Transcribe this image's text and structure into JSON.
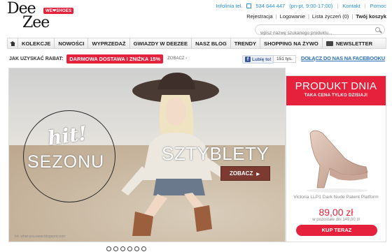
{
  "header": {
    "logo_line1": "Dee",
    "logo_line2": "Zee",
    "logo_badge": "WE❤SHOES",
    "infoline_label": "Infolinia tel.",
    "infoline_number": "534 644 447",
    "infoline_hours": "(pn-pt, 9:00-17:00)",
    "contact_link": "Kontakt",
    "help_link": "Pomoc",
    "register_link": "Rejestracja",
    "login_link": "Logowanie",
    "wishlist_link": "Lista życzeń (0)",
    "cart_link": "Twój koszyk",
    "search_placeholder": "wpisz nazwę szukanego produktu..."
  },
  "nav": {
    "items": [
      "KOLEKCJE",
      "NOWOŚCI",
      "WYPRZEDAŻ",
      "GWIAZDY W DEEZEE",
      "NASZ BLOG",
      "TRENDY",
      "SHOPPING NA ŻYWO",
      "NEWSLETTER"
    ]
  },
  "promo": {
    "label": "JAK UZYSKAĆ RABAT:",
    "badge": "DARMOWA DOSTAWA I ZNIŻKA 15%",
    "link": "ZOBACZ",
    "fb_like": "Lubię to!",
    "fb_count": "151 tys.",
    "fb_join": "DOŁĄCZ DO NAS NA FACEBOOKU"
  },
  "hero": {
    "hit": "hit!",
    "sezonu": "SEZONU",
    "headline": "SZTYBLETY",
    "cta": "ZOBACZ",
    "credit": "fot. what-you-wear.blogspot.com"
  },
  "product": {
    "title": "PRODUKT DNIA",
    "subtitle": "TAKA CENA TYLKO DZISIAJ!",
    "name": "Victoria LLP1 Dark Nude Patent Platform",
    "price": "89,00 zł",
    "old_price": "w pozostałe dni 149,00 zł",
    "buy": "KUP TERAZ"
  },
  "colors": {
    "accent": "#e5213b",
    "link": "#2a8fd0",
    "cta_brown": "#7d3a31"
  },
  "carousel": {
    "dots": 6,
    "active": 0
  }
}
